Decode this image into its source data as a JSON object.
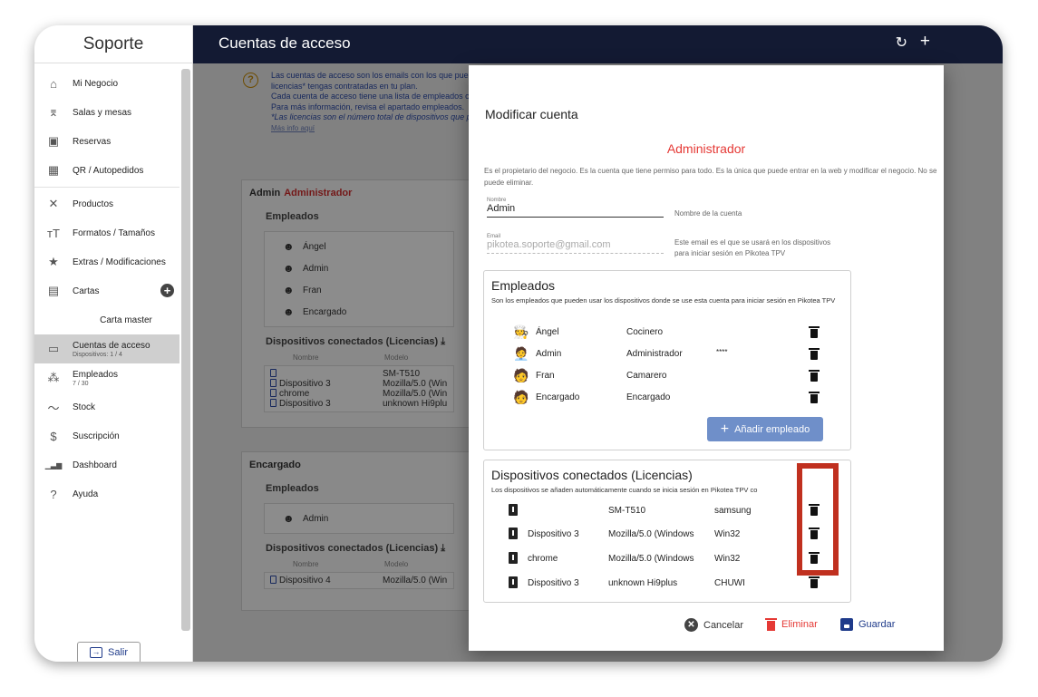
{
  "sidebar": {
    "title": "Soporte",
    "items": [
      {
        "label": "Mi Negocio",
        "icon": "home-icon",
        "glyph": "⌂"
      },
      {
        "label": "Salas y mesas",
        "icon": "table-icon",
        "glyph": "⌆"
      },
      {
        "label": "Reservas",
        "icon": "calendar-icon",
        "glyph": "▣"
      },
      {
        "label": "QR / Autopedidos",
        "icon": "qr-code-icon",
        "glyph": "▦"
      },
      {
        "label": "Productos",
        "icon": "cutlery-icon",
        "glyph": "✕"
      },
      {
        "label": "Formatos / Tamaños",
        "icon": "text-size-icon",
        "glyph": "ᴛT"
      },
      {
        "label": "Extras / Modificaciones",
        "icon": "star-icon",
        "glyph": "★"
      },
      {
        "label": "Cartas",
        "icon": "menu-book-icon",
        "glyph": "▤"
      },
      {
        "label": "Carta master"
      },
      {
        "label": "Cuentas de acceso",
        "sub": "Dispositivos: 1 / 4",
        "icon": "devices-icon",
        "glyph": "▭"
      },
      {
        "label": "Empleados",
        "sub": "7 / 30",
        "icon": "people-icon",
        "glyph": "⁂"
      },
      {
        "label": "Stock",
        "icon": "trend-icon",
        "glyph": "〜"
      },
      {
        "label": "Suscripción",
        "icon": "dollar-icon",
        "glyph": "$"
      },
      {
        "label": "Dashboard",
        "icon": "bar-chart-icon",
        "glyph": "▁▃▆"
      },
      {
        "label": "Ayuda",
        "icon": "help-icon",
        "glyph": "?"
      }
    ],
    "logout": "Salir"
  },
  "header": {
    "title": "Cuentas de acceso",
    "refresh_icon": "↻",
    "add_icon": "+"
  },
  "background": {
    "info_lines": [
      "Las cuentas de acceso son los emails con los que pue",
      "licencias* tengas contratadas en tu plan.",
      "Cada cuenta de acceso tiene una lista de empleados c",
      "Para más información, revisa el apartado empleados.",
      "*Las licencias son el número total de dispositivos que p"
    ],
    "info_more": "Más info aquí",
    "card1": {
      "name": "Admin",
      "role": "Administrador",
      "employees_title": "Empleados",
      "employees": [
        "Ángel",
        "Admin",
        "Fran",
        "Encargado"
      ],
      "devices_title": "Dispositivos conectados (Licencias)",
      "col_name": "Nombre",
      "col_model": "Modelo",
      "devices": [
        {
          "name": "",
          "model": "SM-T510"
        },
        {
          "name": "Dispositivo 3",
          "model": "Mozilla/5.0 (Win"
        },
        {
          "name": "chrome",
          "model": "Mozilla/5.0 (Win"
        },
        {
          "name": "Dispositivo 3",
          "model": "unknown Hi9plu"
        }
      ]
    },
    "card2": {
      "name": "Encargado",
      "employees_title": "Empleados",
      "employees": [
        "Admin"
      ],
      "devices_title": "Dispositivos conectados (Licencias)",
      "col_name": "Nombre",
      "col_model": "Modelo",
      "devices": [
        {
          "name": "Dispositivo 4",
          "model": "Mozilla/5.0 (Win"
        }
      ]
    }
  },
  "modal": {
    "title": "Modificar cuenta",
    "role": "Administrador",
    "description": "Es el propietario del negocio. Es la cuenta que tiene permiso para todo. Es la única que puede entrar en la web y modificar el negocio. No se puede eliminar.",
    "name_label": "Nombre",
    "name_value": "Admin",
    "name_help": "Nombre de la cuenta",
    "email_label": "Email",
    "email_value": "pikotea.soporte@gmail.com",
    "email_help_1": "Este email es el que se usará en los dispositivos",
    "email_help_2": "para iniciar sesión en Pikotea TPV",
    "employees_title": "Empleados",
    "employees_desc": "Son los empleados que pueden usar los dispositivos donde se use esta cuenta para iniciar sesión en Pikotea TPV",
    "employees": [
      {
        "name": "Ángel",
        "role": "Cocinero",
        "pin": ""
      },
      {
        "name": "Admin",
        "role": "Administrador",
        "pin": "****"
      },
      {
        "name": "Fran",
        "role": "Camarero",
        "pin": ""
      },
      {
        "name": "Encargado",
        "role": "Encargado",
        "pin": ""
      }
    ],
    "add_employee": "Añadir empleado",
    "devices_title": "Dispositivos conectados (Licencias)",
    "devices_desc": "Los dispositivos se añaden automáticamente cuando se inicia sesión en Pikotea TPV co",
    "devices": [
      {
        "name": "",
        "model": "SM-T510",
        "brand": "samsung"
      },
      {
        "name": "Dispositivo 3",
        "model": "Mozilla/5.0 (Windows",
        "brand": "Win32"
      },
      {
        "name": "chrome",
        "model": "Mozilla/5.0 (Windows",
        "brand": "Win32"
      },
      {
        "name": "Dispositivo 3",
        "model": "unknown Hi9plus",
        "brand": "CHUWI"
      }
    ],
    "cancel": "Cancelar",
    "delete": "Eliminar",
    "save": "Guardar"
  },
  "colors": {
    "header_bg": "#131a33",
    "accent_red": "#e53935",
    "primary_blue": "#1e3a8a",
    "add_button": "#6f8fc9",
    "highlight_box": "#c0301f"
  }
}
